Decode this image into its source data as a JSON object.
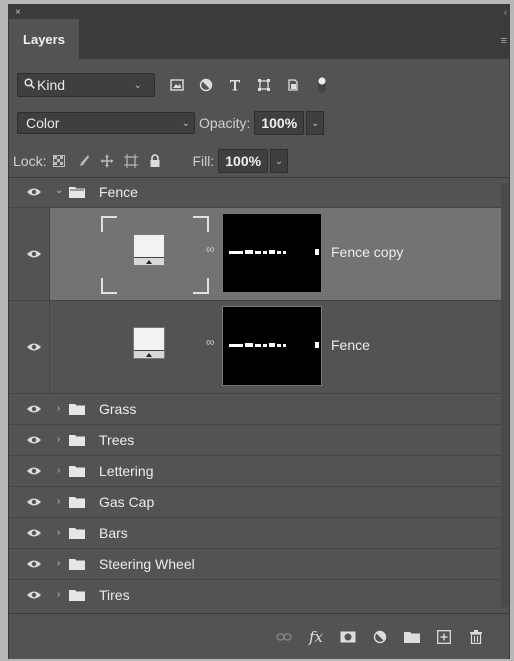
{
  "window": {
    "close": "×"
  },
  "panel": {
    "tab_label": "Layers"
  },
  "filter": {
    "kind_label": "Kind",
    "icons": [
      "image-filter-icon",
      "adjustment-filter-icon",
      "type-filter-icon",
      "shape-filter-icon",
      "smart-object-filter-icon",
      "filter-toggle-icon"
    ]
  },
  "blend": {
    "mode": "Color",
    "opacity_label": "Opacity:",
    "opacity_value": "100%"
  },
  "lock": {
    "label": "Lock:",
    "fill_label": "Fill:",
    "fill_value": "100%"
  },
  "layers": [
    {
      "name": "Fence",
      "type": "group",
      "expanded": true
    },
    {
      "name": "Fence copy",
      "type": "layer",
      "selected": true
    },
    {
      "name": "Fence",
      "type": "layer",
      "selected": false
    },
    {
      "name": "Grass",
      "type": "group",
      "expanded": false
    },
    {
      "name": "Trees",
      "type": "group",
      "expanded": false
    },
    {
      "name": "Lettering",
      "type": "group",
      "expanded": false
    },
    {
      "name": "Gas Cap",
      "type": "group",
      "expanded": false
    },
    {
      "name": "Bars",
      "type": "group",
      "expanded": false
    },
    {
      "name": "Steering Wheel",
      "type": "group",
      "expanded": false
    },
    {
      "name": "Tires",
      "type": "group",
      "expanded": false
    }
  ],
  "footer": {
    "fx_label": "fx"
  },
  "colors": {
    "panel_bg": "#535353",
    "selected_row": "#737373",
    "inset_bg": "#3f3f3f"
  }
}
